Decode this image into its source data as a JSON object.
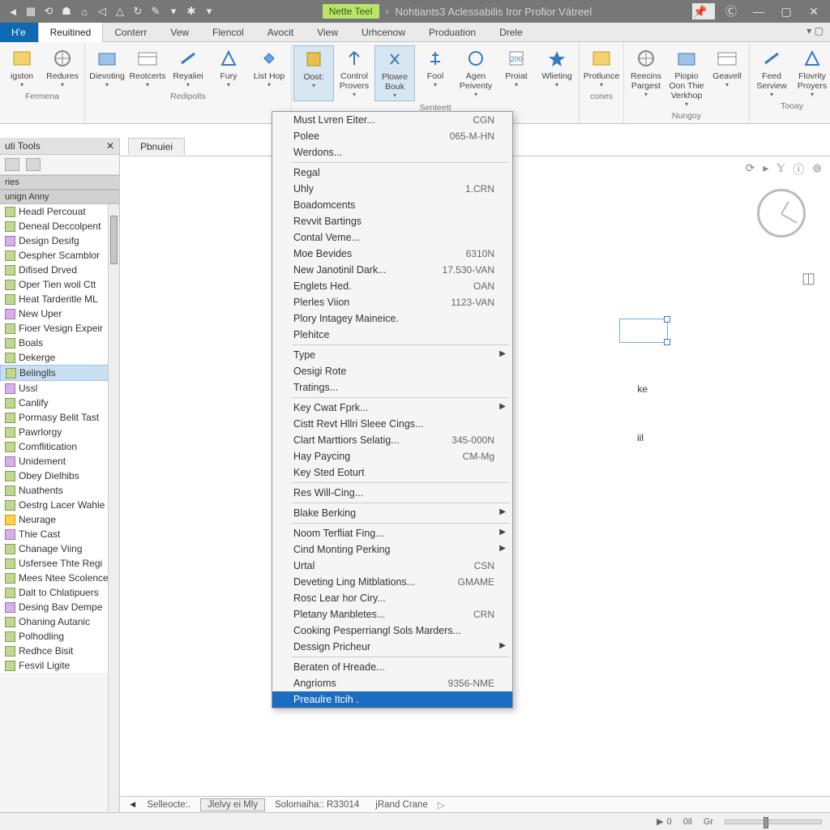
{
  "titlebar": {
    "qat_icons": [
      "back",
      "forward",
      "sync",
      "pin",
      "home",
      "compass",
      "plus",
      "redo",
      "pencil",
      "dropdown",
      "pin2",
      "dropdown2"
    ],
    "badge": "Nette Teel",
    "title": "Nohtiants3 Aclessabilis Iror Profior Vátreel",
    "pin_value": "8"
  },
  "tabs": {
    "file": "H'e",
    "items": [
      "Reuitined",
      "Conterr",
      "Vew",
      "Flencol",
      "Avocit",
      "View",
      "Urhcenow",
      "Produation",
      "Drele"
    ],
    "active_index": 0
  },
  "ribbon": {
    "groups": [
      {
        "label": "Fermena",
        "buttons": [
          {
            "label": "igston"
          },
          {
            "label": "Redures"
          }
        ]
      },
      {
        "label": "Redipolts",
        "buttons": [
          {
            "label": "Dievoting"
          },
          {
            "label": "Reotcerts"
          },
          {
            "label": "Reyaliei"
          },
          {
            "label": "Fury"
          },
          {
            "label": "List Hop"
          }
        ]
      },
      {
        "label": "Senteett",
        "buttons": [
          {
            "label": "Oost:",
            "active": true
          },
          {
            "label": "Control Provers"
          },
          {
            "label": "Plowre Bouk",
            "active": true
          },
          {
            "label": "Fool"
          },
          {
            "label": "Agen Peiventy"
          },
          {
            "label": "Proiat"
          },
          {
            "label": "Wlieting"
          }
        ]
      },
      {
        "label": "cones",
        "buttons": [
          {
            "label": "Protlunce"
          }
        ]
      },
      {
        "label": "Nungoy",
        "buttons": [
          {
            "label": "Reecins Pargest"
          },
          {
            "label": "Piopio Oon Thie Verkhop"
          },
          {
            "label": "Geavell"
          }
        ]
      },
      {
        "label": "Tooay",
        "buttons": [
          {
            "label": "Feed Serview"
          },
          {
            "label": "Flovrity Proyers"
          }
        ]
      }
    ]
  },
  "tool_panel": {
    "title": "uti Tools",
    "sub1": "ries",
    "sub2": "unign Anny",
    "items": [
      "Headl Percouat",
      "Deneal Deccolpent",
      "Design Desifg",
      "Oespher Scamblor",
      "Difised Drved",
      "Oper Tien woil Ctt",
      "Heat Tarderitle ML",
      "New Uper",
      "Fioer Vesign Expeir",
      "Boals",
      "Dekerge",
      "Belinglls",
      "Ussl",
      "Canlify",
      "Pormasy Belit Tast",
      "Pawrlorgy",
      "Comflitication",
      "Unidement",
      "Obey Dielhibs",
      "Nuathents",
      "Oestrg Lacer Wahle",
      "Neurage",
      "Thie Cast",
      "Chanage Viing",
      "Usfersee Thte Regi",
      "Mees Ntee Scolence",
      "Dalt to Chlatipuers",
      "Desing Bav Dempe",
      "Ohaning Autanic",
      "Polhodling",
      "Redhce Bisit",
      "Fesvil Ligite"
    ],
    "selected_index": 11,
    "new_index": 21
  },
  "canvas": {
    "doc_tab": "Pbnuiei",
    "shape_text1": "ke",
    "shape_text2": "iil"
  },
  "context_menu": {
    "items": [
      {
        "label": "Must Lvren Eiter...",
        "shortcut": "CGN"
      },
      {
        "label": "Polee",
        "shortcut": "065-M-HN"
      },
      {
        "label": "Werdons..."
      },
      {
        "sep": true
      },
      {
        "label": "Regal"
      },
      {
        "label": "Uhly",
        "shortcut": "1.CRN"
      },
      {
        "label": "Boadomcents"
      },
      {
        "label": "Revvit Bartings"
      },
      {
        "label": "Contal Veme..."
      },
      {
        "label": "Moe Bevides",
        "shortcut": "6310N"
      },
      {
        "label": "New Janotinil Dark...",
        "shortcut": "17.530-VAN"
      },
      {
        "label": "Englets Hed.",
        "shortcut": "OAN"
      },
      {
        "label": "Plerles Viion",
        "shortcut": "1123-VAN"
      },
      {
        "label": "Plory Intagey Maineice."
      },
      {
        "label": "Plehitce"
      },
      {
        "sep": true
      },
      {
        "label": "Type",
        "submenu": true
      },
      {
        "label": "Oesigi Rote"
      },
      {
        "label": "Tratings..."
      },
      {
        "sep": true
      },
      {
        "label": "Key Cwat Fprk...",
        "submenu": true
      },
      {
        "label": "Cistt Revt Hllri Sleee Cings..."
      },
      {
        "label": "Clart Marttiors Selatig...",
        "shortcut": "345-000N"
      },
      {
        "label": "Hay Paycing",
        "shortcut": "CM-Mg"
      },
      {
        "label": "Key Sted Eoturt"
      },
      {
        "sep": true
      },
      {
        "label": "Res Will-Cing..."
      },
      {
        "sep": true
      },
      {
        "label": "Blake Berking",
        "submenu": true
      },
      {
        "sep": true
      },
      {
        "label": "Noom Terfliat Fing...",
        "submenu": true
      },
      {
        "label": "Cind Monting Perking",
        "submenu": true
      },
      {
        "label": "Urtal",
        "shortcut": "CSN"
      },
      {
        "label": "Deveting Ling Mitblations...",
        "shortcut": "GMAME"
      },
      {
        "label": "Rosc Lear hor Ciry..."
      },
      {
        "label": "Pletany Manbletes...",
        "shortcut": "CRN"
      },
      {
        "label": "Cooking Pesperriangl Sols Marders..."
      },
      {
        "label": "Dessign Pricheur",
        "submenu": true
      },
      {
        "sep": true
      },
      {
        "label": "Beraten of Hreade..."
      },
      {
        "label": "Angrioms",
        "shortcut": "9356-NME"
      },
      {
        "label": "Preaulre Itcih .",
        "highlighted": true
      }
    ]
  },
  "bottom_tabs": {
    "items": [
      "Selleocte:.",
      "Jlelvy ei  Mly",
      "Solomaiha:: R33014",
      "jRand Crane"
    ],
    "active_index": 1
  },
  "status": {
    "items": [
      "0",
      "0il",
      "Gr"
    ]
  }
}
